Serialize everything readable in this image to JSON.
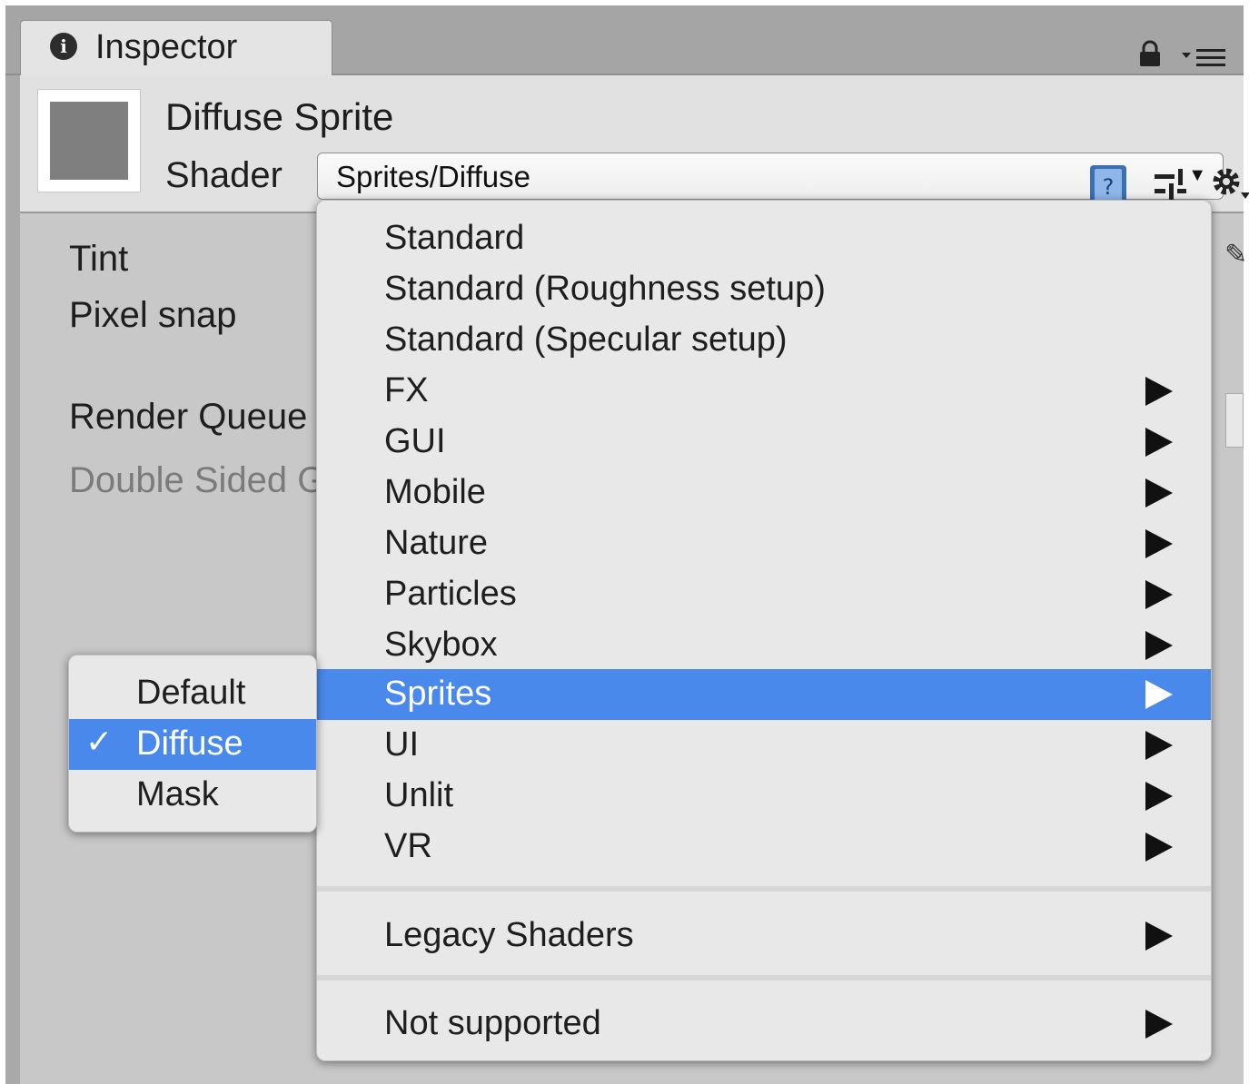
{
  "tab": {
    "label": "Inspector",
    "info_glyph": "i"
  },
  "material": {
    "name": "Diffuse Sprite",
    "shader_label": "Shader",
    "shader_value": "Sprites/Diffuse"
  },
  "properties": {
    "tint": "Tint",
    "pixel_snap": "Pixel snap",
    "render_queue": "Render Queue",
    "double_sided": "Double Sided G"
  },
  "shader_menu": {
    "items": [
      {
        "label": "Standard",
        "submenu": false
      },
      {
        "label": "Standard (Roughness setup)",
        "submenu": false
      },
      {
        "label": "Standard (Specular setup)",
        "submenu": false
      },
      {
        "label": "FX",
        "submenu": true
      },
      {
        "label": "GUI",
        "submenu": true
      },
      {
        "label": "Mobile",
        "submenu": true
      },
      {
        "label": "Nature",
        "submenu": true
      },
      {
        "label": "Particles",
        "submenu": true
      },
      {
        "label": "Skybox",
        "submenu": true
      },
      {
        "label": "Sprites",
        "submenu": true,
        "highlighted": true
      },
      {
        "label": "UI",
        "submenu": true
      },
      {
        "label": "Unlit",
        "submenu": true
      },
      {
        "label": "VR",
        "submenu": true
      },
      {
        "label": "Legacy Shaders",
        "submenu": true
      },
      {
        "label": "Not supported",
        "submenu": true
      }
    ]
  },
  "sprites_submenu": {
    "items": [
      {
        "label": "Default",
        "checked": false
      },
      {
        "label": "Diffuse",
        "checked": true
      },
      {
        "label": "Mask",
        "checked": false
      }
    ],
    "check_glyph": "✓"
  },
  "icons": [
    "info-icon",
    "lock-icon",
    "panel-menu-icon",
    "help-book-icon",
    "sliders-icon",
    "gear-icon",
    "pencil-icon"
  ],
  "colors": {
    "highlight": "#4a89ec",
    "menu_bg": "#e8e8e8",
    "panel_bg": "#c8c8c8",
    "header_bg": "#e1e1e1"
  }
}
